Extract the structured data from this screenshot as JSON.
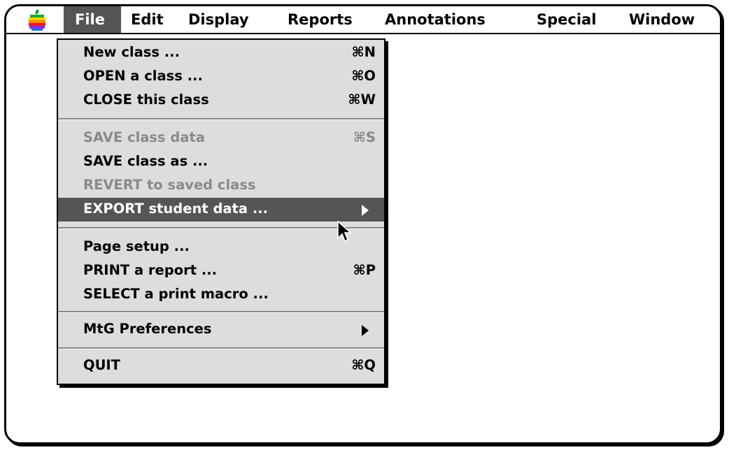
{
  "menubar": {
    "apple_icon": "apple-rainbow-icon",
    "items": [
      {
        "label": "File",
        "active": true
      },
      {
        "label": "Edit"
      },
      {
        "label": "Display"
      },
      {
        "label": "Reports"
      },
      {
        "label": "Annotations"
      },
      {
        "label": "Special"
      },
      {
        "label": "Window"
      }
    ]
  },
  "file_menu": {
    "items": [
      {
        "label": "New class ...",
        "shortcut": "⌘N"
      },
      {
        "label": "OPEN a class ...",
        "shortcut": "⌘O"
      },
      {
        "label": "CLOSE this class",
        "shortcut": "⌘W"
      },
      {
        "label": "SAVE class data",
        "shortcut": "⌘S",
        "disabled": true
      },
      {
        "label": "SAVE class as ..."
      },
      {
        "label": "REVERT to saved class",
        "disabled": true
      },
      {
        "label": "EXPORT student data ...",
        "submenu": true,
        "highlighted": true
      },
      {
        "label": "Page setup ..."
      },
      {
        "label": "PRINT a report ...",
        "shortcut": "⌘P"
      },
      {
        "label": "SELECT a print macro ..."
      },
      {
        "label": "MtG Preferences",
        "submenu": true
      },
      {
        "label": "QUIT",
        "shortcut": "⌘Q"
      }
    ]
  },
  "colors": {
    "highlight": "#555555",
    "menu_background": "#dddddd",
    "disabled_text": "#8a8a8a"
  }
}
